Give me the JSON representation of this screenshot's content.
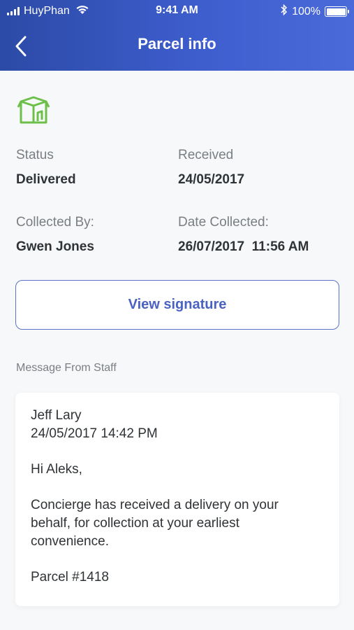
{
  "status_bar": {
    "carrier": "HuyPhan",
    "time": "9:41 AM",
    "battery": "100%"
  },
  "header": {
    "title": "Parcel info",
    "back_icon": "chevron-left-icon"
  },
  "parcel": {
    "icon": "package-icon",
    "status_label": "Status",
    "status_value": "Delivered",
    "received_label": "Received",
    "received_value": "24/05/2017",
    "collected_by_label": "Collected By:",
    "collected_by_value": "Gwen Jones",
    "date_collected_label": "Date Collected:",
    "date_collected_value": "26/07/2017  11:56 AM"
  },
  "actions": {
    "view_signature_label": "View signature"
  },
  "message": {
    "section_label": "Message From Staff",
    "sender": "Jeff Lary",
    "timestamp": "24/05/2017 14:42 PM",
    "greeting": "Hi Aleks,",
    "body_line1": "Concierge has received a delivery on your",
    "body_line2": "behalf, for collection at your earliest",
    "body_line3": "convenience.",
    "parcel_ref": "Parcel #1418"
  },
  "colors": {
    "header_gradient_start": "#2c4aa6",
    "header_gradient_end": "#4a6ad9",
    "accent": "#4a62c0",
    "icon_green": "#6cc04a"
  }
}
